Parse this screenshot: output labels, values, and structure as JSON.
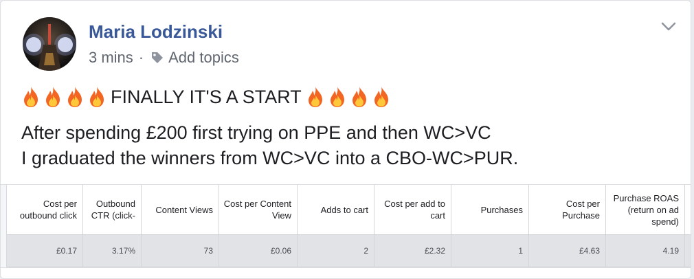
{
  "post": {
    "author": "Maria Lodzinski",
    "time": "3 mins",
    "separator": "·",
    "add_topics": "Add topics",
    "headline": "FINALLY IT'S A START",
    "body_line1": "After spending £200 first trying on PPE and then WC>VC",
    "body_line2": "I graduated the winners from WC>VC into a CBO-WC>PUR."
  },
  "icons": {
    "fire": "fire-emoji",
    "tag": "tag-icon",
    "chevron": "chevron-down-icon"
  },
  "colors": {
    "author": "#385898",
    "meta": "#616770",
    "text": "#1c1e21",
    "table_row": "#e2e3e6"
  },
  "table": {
    "headers": [
      "Cost per outbound click",
      "Outbound CTR (click-",
      "Content Views",
      "Cost per Content View",
      "Adds to cart",
      "Cost per add to cart",
      "Purchases",
      "Cost per Purchase",
      "Purchase ROAS (return on ad spend)"
    ],
    "row": [
      "£0.17",
      "3.17%",
      "73",
      "£0.06",
      "2",
      "£2.32",
      "1",
      "£4.63",
      "4.19"
    ]
  }
}
